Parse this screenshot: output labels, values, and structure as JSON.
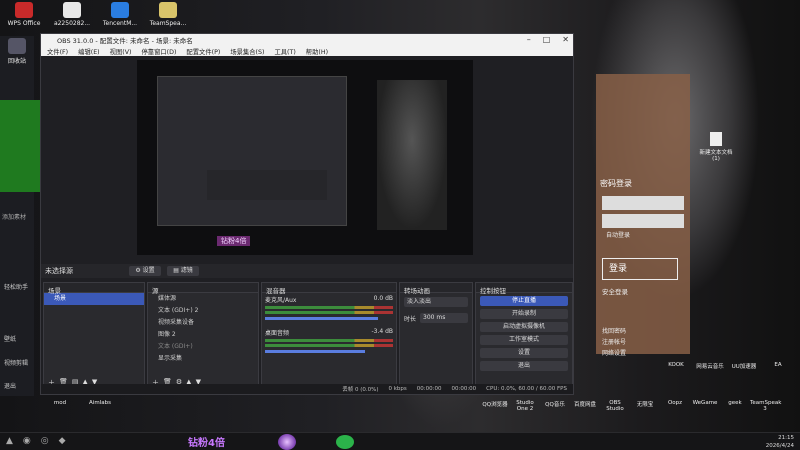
{
  "desktop_icons_top": [
    {
      "label": "WPS Office"
    },
    {
      "label": "a2250282..."
    },
    {
      "label": "TencentM..."
    },
    {
      "label": "TeamSpea..."
    }
  ],
  "left_icons": [
    {
      "label": "回收站"
    },
    {
      "label": "添加素材"
    },
    {
      "label": "轻松助手"
    },
    {
      "label": "壁纸"
    },
    {
      "label": "视频剪辑"
    },
    {
      "label": "退出"
    },
    {
      "label": "最佳品味"
    }
  ],
  "bottom_desktop_icons": [
    {
      "label": "mod"
    },
    {
      "label": "Aimlabs"
    },
    {
      "label": "QQ浏览器"
    },
    {
      "label": "Studio One 2"
    },
    {
      "label": "QQ音乐"
    },
    {
      "label": "百度网盘"
    },
    {
      "label": "OBS Studio"
    },
    {
      "label": "无限宝"
    },
    {
      "label": "Oopz"
    },
    {
      "label": "WeGame"
    },
    {
      "label": "geek"
    },
    {
      "label": "TeamSpeak 3"
    }
  ],
  "right_icons": [
    {
      "label": "新建文本文档 (1)"
    },
    {
      "label": "KOOK"
    },
    {
      "label": "网易云音乐"
    },
    {
      "label": "UU加速器"
    },
    {
      "label": "EA"
    }
  ],
  "obs": {
    "title": "OBS 31.0.0 - 配置文件: 未命名 - 场景: 未命名",
    "menu": [
      "文件(F)",
      "编辑(E)",
      "视图(V)",
      "停靠窗口(D)",
      "配置文件(P)",
      "场景集合(S)",
      "工具(T)",
      "帮助(H)"
    ],
    "source_none": "未选择源",
    "props_btn": "⚙ 设置",
    "filters_btn": "▤ 滤镜",
    "scenes": {
      "title": "场景",
      "items": [
        "场景"
      ]
    },
    "sources": {
      "title": "源",
      "items": [
        "媒体源",
        "文本 (GDI+) 2",
        "视频采集设备",
        "图像 2",
        "文本 (GDI+)",
        "显示采集"
      ]
    },
    "mixer": {
      "title": "混音器",
      "channels": [
        {
          "name": "麦克风/Aux",
          "db": "0.0 dB"
        },
        {
          "name": "桌面音频",
          "db": "-3.4 dB"
        }
      ]
    },
    "transitions": {
      "title": "转场动画",
      "type": "淡入淡出",
      "duration_label": "时长",
      "duration": "300 ms"
    },
    "controls": {
      "title": "控制按钮",
      "buttons": [
        "停止直播",
        "开始录制",
        "启动虚拟摄像机",
        "工作室模式",
        "设置",
        "退出"
      ]
    },
    "status": {
      "dropped": "丢帧 0 (0.0%)",
      "kbps": "0 kbps",
      "time1": "00:00:00",
      "time2": "00:00:00",
      "cpu": "CPU: 0.0%, 60.00 / 60.00 FPS"
    }
  },
  "login": {
    "title": "密码登录",
    "login_btn": "登录",
    "safe": "安全登录",
    "auto": "自动登录",
    "options": [
      "找回密码",
      "注册帐号",
      "网络设置"
    ]
  },
  "taskbar": {
    "banner": "钻粉4倍",
    "clock": "21:15",
    "date": "2026/4/24"
  }
}
